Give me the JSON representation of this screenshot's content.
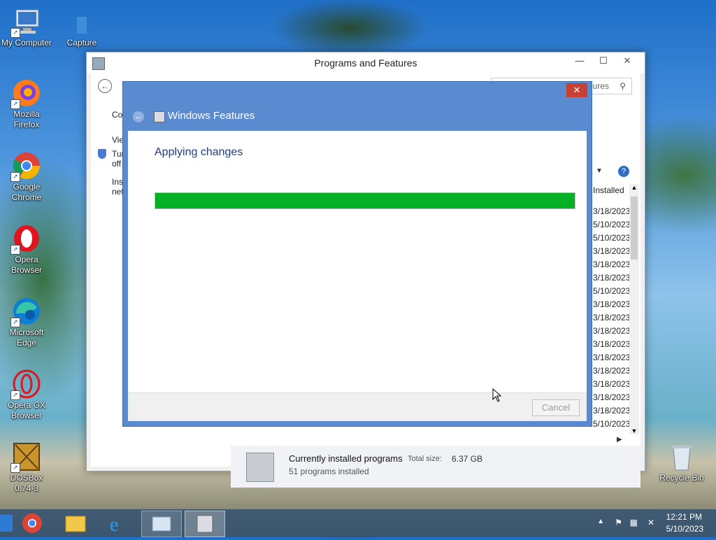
{
  "desktop_icons": [
    {
      "label": "My Computer"
    },
    {
      "label": "Capture"
    },
    {
      "label": "Mozilla Firefox"
    },
    {
      "label": "Google Chrome"
    },
    {
      "label": "Opera Browser"
    },
    {
      "label": "Microsoft Edge"
    },
    {
      "label": "Opera GX Browser"
    },
    {
      "label": "DOSBox 0.74-3"
    },
    {
      "label": "Recycle Bin"
    }
  ],
  "programs_window": {
    "title": "Programs and Features",
    "search_fragment": "ures",
    "sidebar": [
      "Co",
      "Vie",
      "Tur",
      "off",
      "Inst",
      "net"
    ],
    "column_header": "Installed",
    "dates": [
      "3/18/2023",
      "5/10/2023",
      "5/10/2023",
      "3/18/2023",
      "3/18/2023",
      "3/18/2023",
      "5/10/2023",
      "3/18/2023",
      "3/18/2023",
      "3/18/2023",
      "3/18/2023",
      "3/18/2023",
      "3/18/2023",
      "3/18/2023",
      "3/18/2023",
      "3/18/2023",
      "5/10/2023"
    ],
    "status": {
      "title": "Currently installed programs",
      "size_label": "Total size:",
      "size_value": "6.37 GB",
      "count": "51 programs installed"
    }
  },
  "dialog": {
    "title": "Windows Features",
    "heading": "Applying changes",
    "progress": 1.0,
    "cancel": "Cancel"
  },
  "taskbar": {
    "time": "12:21 PM",
    "date": "5/10/2023"
  },
  "colors": {
    "progress": "#06b025",
    "dialog_frame": "#5a8ad0",
    "heading": "#1e3f7a"
  }
}
